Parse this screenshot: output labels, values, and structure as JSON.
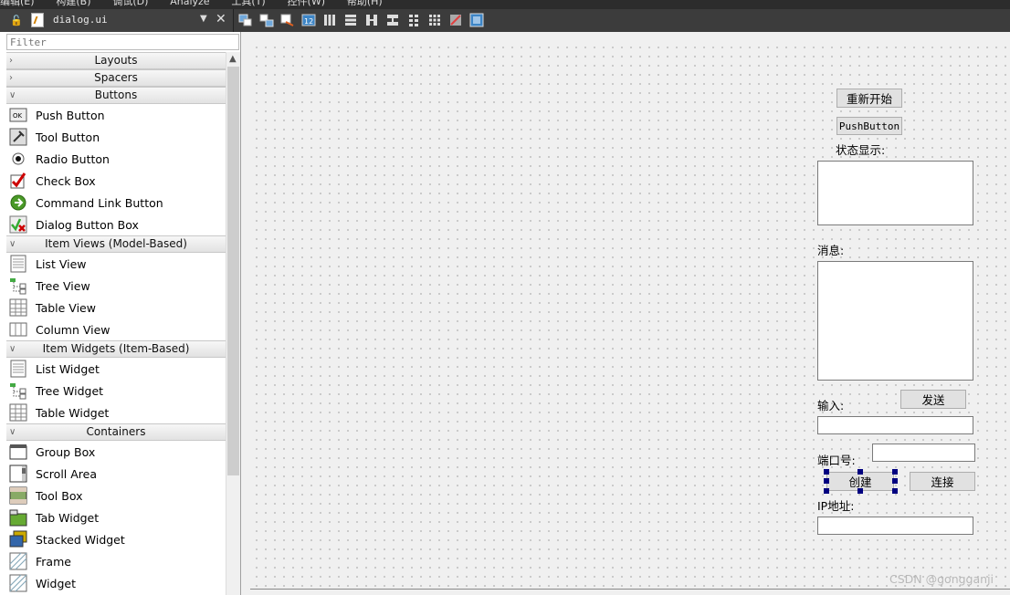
{
  "menubar": [
    "编辑(E)",
    "构建(B)",
    "调试(D)",
    "Analyze",
    "工具(T)",
    "控件(W)",
    "帮助(H)"
  ],
  "toolbar": {
    "file_name": "dialog.ui"
  },
  "widget_box": {
    "filter_placeholder": "Filter",
    "categories": [
      {
        "label": "Layouts",
        "expanded": false,
        "items": []
      },
      {
        "label": "Spacers",
        "expanded": false,
        "items": []
      },
      {
        "label": "Buttons",
        "expanded": true,
        "items": [
          {
            "label": "Push Button",
            "icon": "push-button-icon"
          },
          {
            "label": "Tool Button",
            "icon": "tool-button-icon"
          },
          {
            "label": "Radio Button",
            "icon": "radio-button-icon"
          },
          {
            "label": "Check Box",
            "icon": "check-box-icon"
          },
          {
            "label": "Command Link Button",
            "icon": "command-link-icon"
          },
          {
            "label": "Dialog Button Box",
            "icon": "dialog-button-box-icon"
          }
        ]
      },
      {
        "label": "Item Views (Model-Based)",
        "expanded": true,
        "items": [
          {
            "label": "List View",
            "icon": "list-view-icon"
          },
          {
            "label": "Tree View",
            "icon": "tree-view-icon"
          },
          {
            "label": "Table View",
            "icon": "table-view-icon"
          },
          {
            "label": "Column View",
            "icon": "column-view-icon"
          }
        ]
      },
      {
        "label": "Item Widgets (Item-Based)",
        "expanded": true,
        "items": [
          {
            "label": "List Widget",
            "icon": "list-view-icon"
          },
          {
            "label": "Tree Widget",
            "icon": "tree-view-icon"
          },
          {
            "label": "Table Widget",
            "icon": "table-view-icon"
          }
        ]
      },
      {
        "label": "Containers",
        "expanded": true,
        "items": [
          {
            "label": "Group Box",
            "icon": "group-box-icon"
          },
          {
            "label": "Scroll Area",
            "icon": "scroll-area-icon"
          },
          {
            "label": "Tool Box",
            "icon": "tool-box-icon"
          },
          {
            "label": "Tab Widget",
            "icon": "tab-widget-icon"
          },
          {
            "label": "Stacked Widget",
            "icon": "stacked-widget-icon"
          },
          {
            "label": "Frame",
            "icon": "frame-icon"
          },
          {
            "label": "Widget",
            "icon": "widget-icon"
          }
        ]
      }
    ]
  },
  "form": {
    "restart_button": "重新开始",
    "push_button": "PushButton",
    "status_label": "状态显示:",
    "message_label": "消息:",
    "input_label": "输入:",
    "send_button": "发送",
    "port_label": "端口号:",
    "create_button": "创建",
    "connect_button": "连接",
    "ip_label": "IP地址:"
  },
  "watermark": "CSDN @gongganji"
}
